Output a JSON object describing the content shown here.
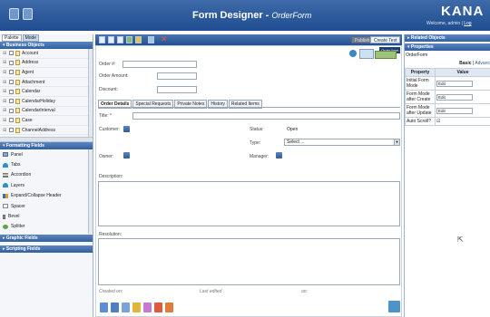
{
  "app": {
    "title": "Form Designer - ",
    "subtitle": "OrderForm",
    "brand": "KANA",
    "welcome_prefix": "Welcome, admin | ",
    "welcome_link": "Log"
  },
  "left_panel": {
    "tabs": [
      "Palette",
      "Mode"
    ],
    "sections": {
      "business_objects": "Business Objects",
      "formatting_fields": "Formatting Fields",
      "graphic_fields": "Graphic Fields",
      "scripting_fields": "Scripting Fields"
    },
    "business_objects": [
      "Account",
      "Address",
      "Agent",
      "Attachment",
      "Calendar",
      "CalendarHoliday",
      "CalendarInterval",
      "Case",
      "ChannelAddress"
    ],
    "formatting_items": [
      {
        "label": "Panel",
        "icon": "panel-icon"
      },
      {
        "label": "Tabs",
        "icon": "tabs-icon"
      },
      {
        "label": "Accordion",
        "icon": "accordion-icon"
      },
      {
        "label": "Layers",
        "icon": "layers-icon"
      },
      {
        "label": "Expand/Collapse Header",
        "icon": "expand-collapse-icon"
      },
      {
        "label": "Spacer",
        "icon": "spacer-icon"
      },
      {
        "label": "Bevel",
        "icon": "bevel-icon"
      },
      {
        "label": "Splitter",
        "icon": "splitter-icon"
      }
    ]
  },
  "toolbar": {
    "publish": "Publish",
    "create_test": "Create Test",
    "order_form_badge": "Order form"
  },
  "form": {
    "order_no_label": "Order #:",
    "order_amount_label": "Order Amount:",
    "discount_label": "Discount:",
    "tabs": [
      "Order Details",
      "Special Requests",
      "Private Notes",
      "History",
      "Related Items"
    ],
    "title_label": "Title: *",
    "customer_label": "Customer:",
    "status_label": "Status:",
    "status_value": "Open",
    "type_label": "Type:",
    "type_value": "Select ...",
    "owner_label": "Owner:",
    "manager_label": "Manager:",
    "description_label": "Description:",
    "resolution_label": "Resolution:",
    "created_on_label": "Created on:",
    "last_edited_label": "Last edited",
    "on_label": "on:"
  },
  "right_panel": {
    "related_objects": "Related Objects",
    "properties": "Properties",
    "selected_object": "OrderForm",
    "mode_basic": "Basic",
    "mode_sep": " | ",
    "mode_advanced": "Advanc",
    "col_property": "Property",
    "col_value": "Value",
    "rows": [
      {
        "property": "Initial Form Mode",
        "value": "Edit"
      },
      {
        "property": "Form Mode after Create",
        "value": "Edit"
      },
      {
        "property": "Form Mode after Update",
        "value": "Edit"
      },
      {
        "property": "Auto Scroll?",
        "value": "☑"
      }
    ]
  },
  "colors": {
    "header": "#2a5a9a",
    "section_header": "#3f6fad",
    "background": "#ffffff"
  }
}
